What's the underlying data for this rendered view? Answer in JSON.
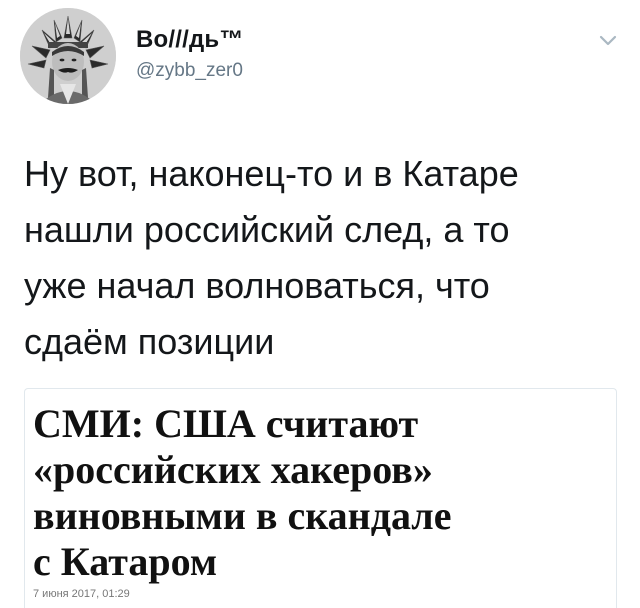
{
  "author": {
    "display_name": "Во///дь™",
    "handle": "@zybb_zer0",
    "avatar_icon": "portrait-with-headdress-avatar"
  },
  "header": {
    "menu_icon": "chevron-down-icon"
  },
  "tweet": {
    "text_lines": [
      "Ну вот, наконец-то и в Катаре",
      "нашли российский след, а то",
      "уже начал волноваться, что",
      "сдаём позиции"
    ]
  },
  "attachment": {
    "headline_lines": [
      "СМИ: США считают",
      "«российских хакеров»",
      "виновными в скандале",
      "с Катаром"
    ],
    "date": "7 июня 2017, 01:29"
  },
  "colors": {
    "text": "#14171a",
    "secondary": "#657786",
    "headline": "#111111"
  }
}
